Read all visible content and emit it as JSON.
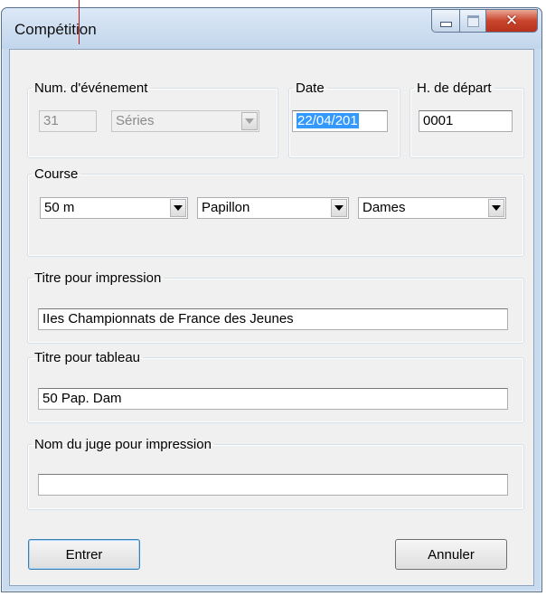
{
  "window": {
    "title": "Compétition"
  },
  "event_group": {
    "legend": "Num. d'événement",
    "number_value": "31",
    "type_value": "Séries"
  },
  "date_group": {
    "legend": "Date",
    "value": "22/04/201"
  },
  "start_group": {
    "legend": "H. de départ",
    "value": "0001"
  },
  "course_group": {
    "legend": "Course",
    "distance": "50 m",
    "stroke": "Papillon",
    "gender": "Dames"
  },
  "print_title_group": {
    "legend": "Titre pour impression",
    "value": "IIes Championnats de France des Jeunes"
  },
  "board_title_group": {
    "legend": "Titre pour tableau",
    "value": "50 Pap. Dam"
  },
  "judge_group": {
    "legend": "Nom du juge pour impression",
    "value": ""
  },
  "buttons": {
    "enter": "Entrer",
    "cancel": "Annuler"
  },
  "colors": {
    "selection": "#3399ff",
    "close_button": "#c9452c",
    "window_frame": "#c9dcef"
  }
}
